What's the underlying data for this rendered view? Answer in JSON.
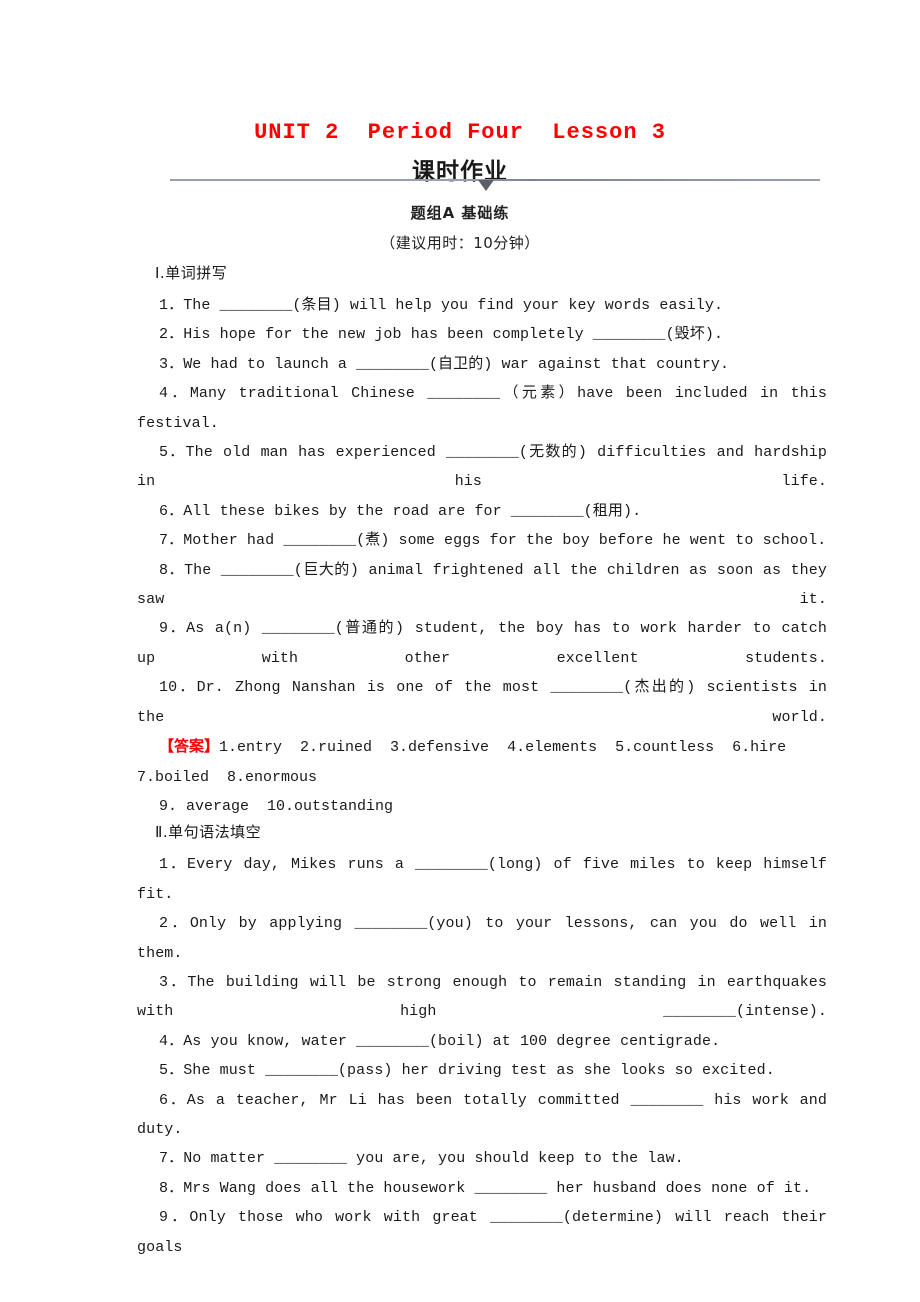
{
  "header": {
    "title": "UNIT 2  Period Four  Lesson 3",
    "banner": "课时作业",
    "group": "题组A  基础练",
    "time": "（建议用时：10分钟）",
    "title_color": "#fe0000"
  },
  "section1": {
    "heading": "Ⅰ.单词拼写",
    "questions": [
      "1．The ________(条目) will help you find your key words easily.",
      "2．His hope for the new job has been completely ________(毁坏).",
      "3．We had to launch a ________(自卫的) war against that country.",
      "4．Many traditional Chinese ________（元素）have been included in this festival.",
      "5．The old man has experienced ________(无数的) difficulties and hardship in his life.",
      "6．All these bikes by the road are for ________(租用).",
      "7．Mother had ________(煮) some eggs for the boy before he went to school.",
      "8．The ________(巨大的) animal frightened all the children as soon as they saw it.",
      "9．As a(n) ________(普通的) student, the boy has to work harder to catch up with other excellent students.",
      "10．Dr. Zhong Nanshan is one of the most ________(杰出的) scientists in the world."
    ],
    "answer_tag": "【答案】",
    "answer_line1": "1.entry  2.ruined  3.defensive  4.elements  5.countless  6.hire 7.boiled  8.enormous",
    "answer_line2": "9. average  10.outstanding"
  },
  "section2": {
    "heading": "Ⅱ.单句语法填空",
    "questions": [
      "1．Every day, Mikes runs a ________(long) of five miles to keep himself fit.",
      "2．Only by applying ________(you) to your lessons, can you do well in them.",
      "3．The building will be strong enough to remain standing in earthquakes with high ________(intense).",
      "4．As you know, water ________(boil) at 100 degree centigrade.",
      "5．She must ________(pass) her driving test as she looks so excited.",
      "6．As a teacher, Mr Li has been totally committed ________ his work and duty.",
      "7．No matter ________ you are, you should keep to the law.",
      "8．Mrs Wang does all the housework ________ her husband does none of it.",
      "9．Only those who work with great ________(determine) will reach their goals"
    ]
  }
}
